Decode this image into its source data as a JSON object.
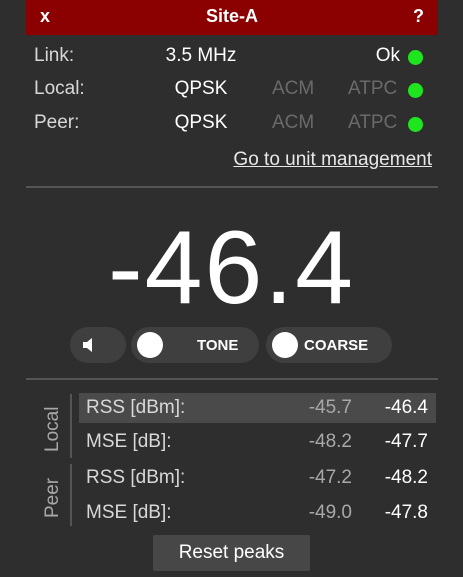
{
  "titlebar": {
    "close": "x",
    "title": "Site-A",
    "help": "?"
  },
  "status": {
    "link": {
      "label": "Link:",
      "value": "3.5 MHz",
      "state": "Ok",
      "state_color": "#1ee51e"
    },
    "local": {
      "label": "Local:",
      "modulation": "QPSK",
      "acm": "ACM",
      "atpc": "ATPC",
      "dot_color": "#1ee51e"
    },
    "peer": {
      "label": "Peer:",
      "modulation": "QPSK",
      "acm": "ACM",
      "atpc": "ATPC",
      "dot_color": "#1ee51e"
    }
  },
  "unit_link": "Go to unit management",
  "reading": "-46.4",
  "controls": {
    "speaker_icon": "speaker-icon",
    "tone_label": "TONE",
    "coarse_label": "COARSE"
  },
  "measurements": {
    "local_label": "Local",
    "peer_label": "Peer",
    "rows": [
      {
        "label": "RSS [dBm]:",
        "current": "-45.7",
        "peak": "-46.4"
      },
      {
        "label": "MSE [dB]:",
        "current": "-48.2",
        "peak": "-47.7"
      },
      {
        "label": "RSS [dBm]:",
        "current": "-47.2",
        "peak": "-48.2"
      },
      {
        "label": "MSE [dB]:",
        "current": "-49.0",
        "peak": "-47.8"
      }
    ]
  },
  "reset_label": "Reset peaks",
  "colors": {
    "titlebar": "#8b0000",
    "background": "#2e2e2e",
    "status_ok": "#1ee51e"
  }
}
